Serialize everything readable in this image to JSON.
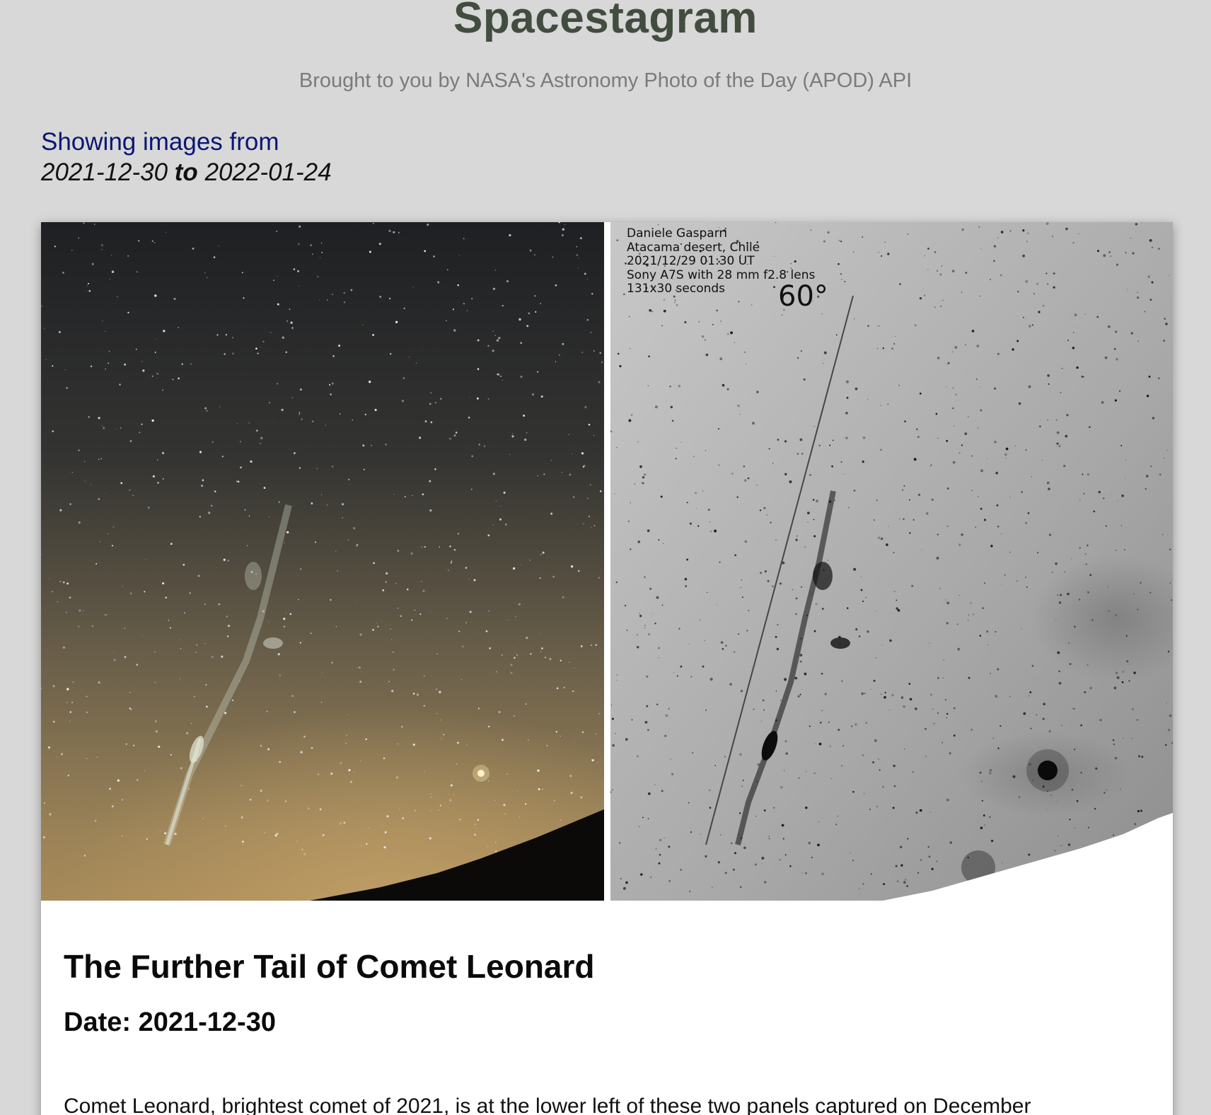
{
  "header": {
    "title": "Spacestagram",
    "subtitle": "Brought to you by NASA's Astronomy Photo of the Day (APOD) API"
  },
  "range": {
    "label": "Showing images from",
    "start": "2021-12-30",
    "separator": "to",
    "end": "2022-01-24"
  },
  "post": {
    "title": "The Further Tail of Comet Leonard",
    "date_label": "Date:",
    "date": "2021-12-30",
    "description": "Comet Leonard, brightest comet of 2021, is at the lower left of these two panels captured on December",
    "image_caption_lines": [
      "Daniele Gasparri",
      "Atacama desert, Chile",
      "2021/12/29 01:30 UT",
      "Sony A7S with 28 mm f2.8 lens",
      "131x30 seconds"
    ],
    "image_angle_label": "60°"
  },
  "colors": {
    "background": "#d8d8d8",
    "title": "#434d3f",
    "subtitle": "#7b7b7b",
    "range_label": "#0c1670",
    "card": "#ffffff"
  }
}
